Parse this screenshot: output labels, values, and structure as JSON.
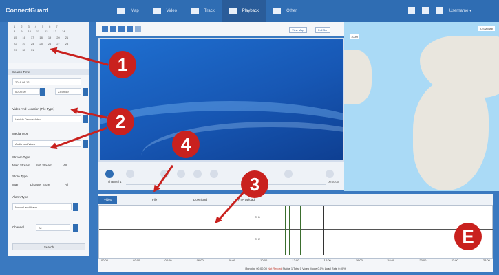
{
  "app": {
    "brand": "ConnectGuard"
  },
  "nav": {
    "items": [
      {
        "label": "Map",
        "icon": "map-icon"
      },
      {
        "label": "Video",
        "icon": "video-icon"
      },
      {
        "label": "Track",
        "icon": "track-icon"
      },
      {
        "label": "Playback",
        "icon": "playback-icon",
        "active": true
      },
      {
        "label": "Other",
        "icon": "grid-icon"
      }
    ],
    "user": "Username ▾"
  },
  "left": {
    "search_title": "Search Time",
    "date_value": "2016-08-12",
    "time_start": "00:00:00",
    "time_end": "23:59:59",
    "location_label": "Video And Location (File Type)",
    "location_value": "Vehicle Device/Video",
    "media_label": "Media Type",
    "media_value": "Audio and Video",
    "stream_label": "Stream Type",
    "stream_opts": [
      "Main Stream",
      "Sub Stream",
      "All"
    ],
    "store_label": "Store Type",
    "store_opts": [
      "Main",
      "Disaster Store",
      "All"
    ],
    "alarm_label": "Alarm Type",
    "alarm_value": "Normal and Alarm",
    "channel_label": "Channel",
    "channel_value": "All",
    "search_button": "Search"
  },
  "video_toolbar": {
    "btn1": "View Map",
    "btn2": "Full Scr"
  },
  "player": {
    "channel": "channel 1",
    "time": "00:00:00"
  },
  "map": {
    "tag": "100m",
    "dropdown": "OSM Map"
  },
  "tabs": [
    "Video",
    "File",
    "Download",
    "FTP Upload"
  ],
  "timeline": {
    "ch1": "CH1",
    "ch2": "CH2",
    "axis": [
      "00:00",
      "02:00",
      "04:00",
      "06:00",
      "08:00",
      "10:00",
      "12:00",
      "14:00",
      "16:00",
      "18:00",
      "20:00",
      "22:00",
      "24:00"
    ]
  },
  "status": {
    "text1": "Running 00:00:00",
    "text2": "Not Record",
    "text3": "Status 1 Total 0 ",
    "text4": "Video Mode 0.0%  Load Rate 0.00%"
  },
  "callouts": [
    "1",
    "2",
    "4",
    "3",
    "E"
  ]
}
